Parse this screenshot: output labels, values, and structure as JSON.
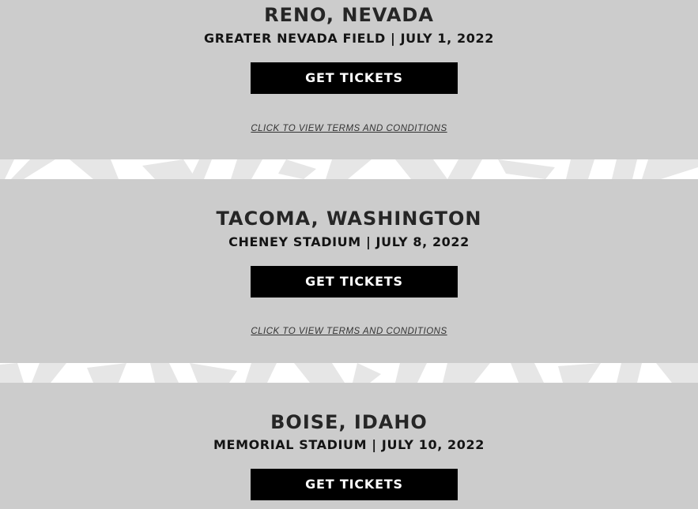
{
  "events": [
    {
      "city": "RENO, NEVADA",
      "venue_date": "GREATER NEVADA FIELD | JULY 1, 2022",
      "button_label": "GET TICKETS",
      "terms_label": "CLICK TO VIEW TERMS AND CONDITIONS"
    },
    {
      "city": "TACOMA, WASHINGTON",
      "venue_date": "CHENEY STADIUM | JULY 8, 2022",
      "button_label": "GET TICKETS",
      "terms_label": "CLICK TO VIEW TERMS AND CONDITIONS"
    },
    {
      "city": "BOISE, IDAHO",
      "venue_date": "MEMORIAL STADIUM | JULY 10, 2022",
      "button_label": "GET TICKETS"
    }
  ],
  "colors": {
    "card_background": "#cccccc",
    "divider_background": "#ffffff",
    "divider_pattern": "#e6e6e6",
    "button_background": "#000000",
    "button_text": "#ffffff",
    "heading_text": "#262626"
  }
}
